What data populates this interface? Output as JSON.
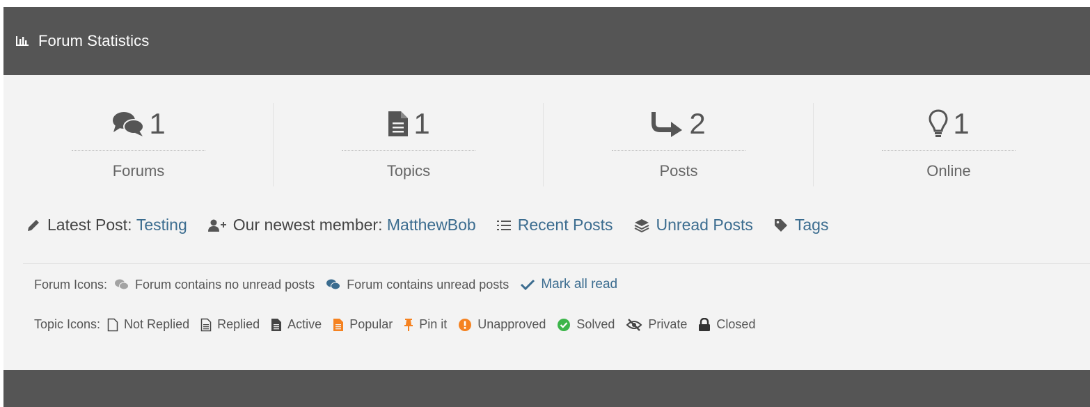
{
  "header": {
    "title": "Forum Statistics",
    "icon": "bar-chart-icon"
  },
  "stats": [
    {
      "icon": "comments-icon",
      "value": "1",
      "label": "Forums"
    },
    {
      "icon": "file-icon",
      "value": "1",
      "label": "Topics"
    },
    {
      "icon": "reply-arrow-icon",
      "value": "2",
      "label": "Posts"
    },
    {
      "icon": "lightbulb-icon",
      "value": "1",
      "label": "Online"
    }
  ],
  "infobar": {
    "latest_post_label": "Latest Post:",
    "latest_post_link": "Testing",
    "newest_member_label": "Our newest member:",
    "newest_member_link": "MatthewBob",
    "recent_posts": "Recent Posts",
    "unread_posts": "Unread Posts",
    "tags": "Tags"
  },
  "forum_icons": {
    "heading": "Forum Icons:",
    "no_unread": "Forum contains no unread posts",
    "unread": "Forum contains unread posts",
    "mark_all_read": "Mark all read"
  },
  "topic_icons": {
    "heading": "Topic Icons:",
    "items": [
      "Not Replied",
      "Replied",
      "Active",
      "Popular",
      "Pin it",
      "Unapproved",
      "Solved",
      "Private",
      "Closed"
    ]
  },
  "colors": {
    "header_bg": "#555555",
    "panel_bg": "#f3f3f3",
    "link": "#3b6c8f",
    "popular": "#f58220",
    "solved": "#3cb54a"
  }
}
